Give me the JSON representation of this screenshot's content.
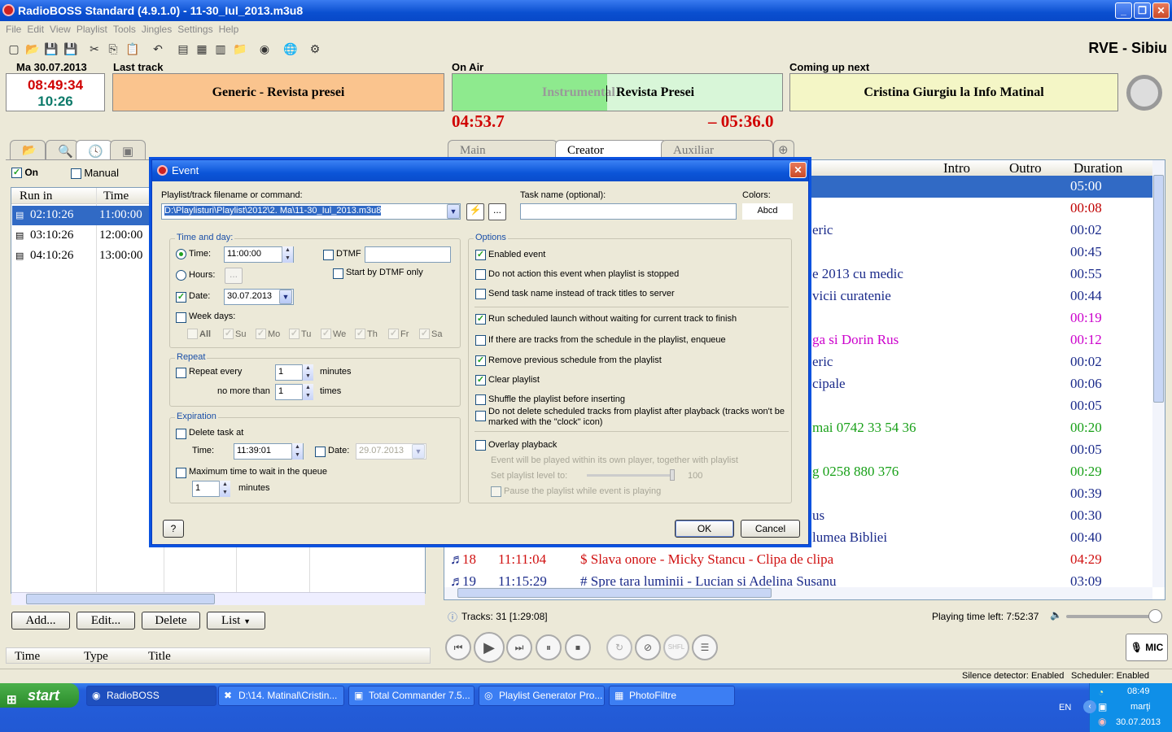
{
  "window": {
    "title": "RadioBOSS Standard (4.9.1.0) - 11-30_Iul_2013.m3u8",
    "minimize": "_",
    "maximize": "❐",
    "close": "✕"
  },
  "menu": [
    "File",
    "Edit",
    "View",
    "Playlist",
    "Tools",
    "Jingles",
    "Settings",
    "Help"
  ],
  "station": "RVE - Sibiu",
  "header": {
    "date": "Ma 30.07.2013",
    "clock_time": "08:49:34",
    "clock_elapsed": "10:26",
    "last_track_label": "Last track",
    "last_track": "Generic - Revista presei",
    "on_air_label": "On Air",
    "on_air_prev": "Instrumental",
    "on_air": "Revista Presei",
    "on_air_elapsed": "04:53.7",
    "on_air_remaining": "– 05:36.0",
    "on_air_progress": 0.47,
    "coming_label": "Coming up next",
    "coming": "Cristina Giurgiu la Info Matinal"
  },
  "left": {
    "tab_icons": [
      "folder-icon",
      "search-icon",
      "clock-icon",
      "calendar-icon"
    ],
    "on_label": "On",
    "manual_label": "Manual",
    "columns": [
      "Run in",
      "Time"
    ],
    "rows": [
      {
        "run": "02:10:26",
        "time": "11:00:00"
      },
      {
        "run": "03:10:26",
        "time": "12:00:00"
      },
      {
        "run": "04:10:26",
        "time": "13:00:00"
      }
    ],
    "buttons": {
      "add": "Add...",
      "edit": "Edit...",
      "delete": "Delete",
      "list": "List"
    },
    "bottom_columns": [
      "Time",
      "Type",
      "Title"
    ]
  },
  "right": {
    "tabs": [
      "Main",
      "Creator",
      "Auxiliar"
    ],
    "columns": [
      "Intro",
      "Outro",
      "Duration"
    ],
    "rows": [
      {
        "title": "",
        "dur": "05:00",
        "color": "#ffffff",
        "sel": true
      },
      {
        "title": "",
        "dur": "00:08",
        "color": "#c00000"
      },
      {
        "title": "eric",
        "dur": "00:02",
        "color": "#1a2a8a"
      },
      {
        "title": "",
        "dur": "00:45",
        "color": "#1a2a8a"
      },
      {
        "title": "e 2013 cu medic",
        "dur": "00:55",
        "color": "#1a2a8a"
      },
      {
        "title": "vicii curatenie",
        "dur": "00:44",
        "color": "#1a2a8a"
      },
      {
        "title": "",
        "dur": "00:19",
        "color": "#cc00cc"
      },
      {
        "title": "ga si Dorin Rus",
        "dur": "00:12",
        "color": "#cc00cc"
      },
      {
        "title": "eric",
        "dur": "00:02",
        "color": "#1a2a8a"
      },
      {
        "title": "cipale",
        "dur": "00:06",
        "color": "#1a2a8a"
      },
      {
        "title": "",
        "dur": "00:05",
        "color": "#1a2a8a"
      },
      {
        "title": "mai 0742 33 54 36",
        "dur": "00:20",
        "color": "#18a018"
      },
      {
        "title": "",
        "dur": "00:05",
        "color": "#1a2a8a"
      },
      {
        "title": "g 0258 880 376",
        "dur": "00:29",
        "color": "#18a018"
      },
      {
        "title": "",
        "dur": "00:39",
        "color": "#1a2a8a"
      },
      {
        "title": "us",
        "dur": "00:30",
        "color": "#1a2a8a"
      },
      {
        "title": " lumea Bibliei",
        "dur": "00:40",
        "color": "#1a2a8a"
      }
    ],
    "row18": {
      "num": "18",
      "time": "11:11:04",
      "title": "$ Slava onore - Micky Stancu - Clipa de clipa",
      "dur": "04:29",
      "color": "#d01010"
    },
    "row19": {
      "num": "19",
      "time": "11:15:29",
      "title": "# Spre tara luminii - Lucian si Adelina Susanu",
      "dur": "03:09",
      "color": "#1a2a8a"
    },
    "tracks": "Tracks: 31 [1:29:08]",
    "playing_left": "Playing time left: 7:52:37",
    "mic": "MIC",
    "shfl": "SHFL"
  },
  "status": {
    "silence": "Silence detector: Enabled",
    "scheduler": "Scheduler: Enabled"
  },
  "dialog": {
    "title": "Event",
    "file_label": "Playlist/track filename or command:",
    "file_value": "D:\\Playlisturi\\Playlist\\2012\\2. Ma\\11-30_Iul_2013.m3u8",
    "task_label": "Task name (optional):",
    "colors_label": "Colors:",
    "colors_sample": "Abcd",
    "browse": "...",
    "timeday": {
      "label": "Time and day:",
      "time_label": "Time:",
      "time_value": "11:00:00",
      "hours_label": "Hours:",
      "hours_btn": "...",
      "date_label": "Date:",
      "date_value": "30.07.2013",
      "weekdays_label": "Week days:",
      "days": [
        "All",
        "Su",
        "Mo",
        "Tu",
        "We",
        "Th",
        "Fr",
        "Sa"
      ],
      "dtmf_label": "DTMF",
      "dtmf_only": "Start by DTMF only"
    },
    "repeat": {
      "label": "Repeat",
      "every": "Repeat every",
      "every_value": "1",
      "minutes": "minutes",
      "nomore": "no more than",
      "nomore_value": "1",
      "times": "times"
    },
    "expiration": {
      "label": "Expiration",
      "delete_at": "Delete task at",
      "time_label": "Time:",
      "time_value": "11:39:01",
      "date_label": "Date:",
      "date_value": "29.07.2013",
      "maxwait": "Maximum time to wait in the queue",
      "maxwait_value": "1",
      "minutes": "minutes"
    },
    "options": {
      "label": "Options",
      "items": [
        {
          "text": "Enabled event",
          "checked": true
        },
        {
          "text": "Do not action this event when playlist is stopped",
          "checked": false
        },
        {
          "text": "Send task name instead of track titles to server",
          "checked": false
        },
        {
          "text": "Run scheduled launch without waiting for current track to finish",
          "checked": true
        },
        {
          "text": "If there are tracks from the schedule in the playlist, enqueue",
          "checked": false
        },
        {
          "text": "Remove previous schedule from the playlist",
          "checked": true
        },
        {
          "text": "Clear playlist",
          "checked": true
        },
        {
          "text": "Shuffle the playlist before inserting",
          "checked": false
        },
        {
          "text": "Do not delete scheduled tracks from playlist after playback (tracks won't be marked with the \"clock\" icon)",
          "checked": false
        },
        {
          "text": "Overlay playback",
          "checked": false
        }
      ],
      "overlay_note": "Event will be played within its own player, together with playlist",
      "setlevel": "Set playlist level to:",
      "level_value": "100",
      "level": 1.0,
      "pause": "Pause the playlist while event is playing"
    },
    "help": "?",
    "ok": "OK",
    "cancel": "Cancel"
  },
  "taskbar": {
    "start": "start",
    "tasks": [
      "RadioBOSS",
      "D:\\14. Matinal\\Cristin...",
      "Total Commander 7.5...",
      "Playlist Generator Pro...",
      "PhotoFiltre"
    ],
    "lang": "EN",
    "time": "08:49",
    "day": "marţi",
    "date": "30.07.2013"
  }
}
